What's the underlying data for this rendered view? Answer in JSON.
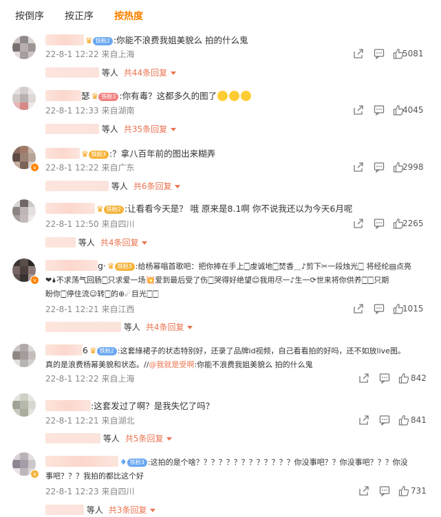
{
  "tabs": [
    "按倒序",
    "按正序",
    "按热度"
  ],
  "active_tab": "按热度",
  "colors": {
    "accent": "#ff8200",
    "link": "#eb7350",
    "meta": "#888888"
  },
  "action_icons": [
    "share-icon",
    "comment-icon",
    "like-icon"
  ],
  "comments": [
    {
      "badge": "铁粉2",
      "text": ":你能不浪费我姐美貌么 拍的什么鬼",
      "time": "22-8-1 12:22",
      "location": "来自上海",
      "likes": "5081",
      "reply_suffix": "等人",
      "reply_total": "共44条回复"
    },
    {
      "name_visible": "瑟",
      "badge": "铁粉3",
      "text": ":你有毒？这都多久的图了",
      "time": "22-8-1 12:33",
      "location": "来自湖南",
      "likes": "4045",
      "reply_suffix": "等人",
      "reply_total": "共35条回复"
    },
    {
      "badge": "铁粉3",
      "text": ":？拿八百年前的图出来糊弄",
      "time": "22-8-1 12:22",
      "location": "来自广东",
      "likes": "2998",
      "reply_suffix": "等人",
      "reply_total": "共6条回复"
    },
    {
      "badge": "铁粉2",
      "text": ":让看看今天是？ 哦 原来是8.1啊 你不说我还以为今天6月呢",
      "time": "22-8-1 12:50",
      "location": "来自四川",
      "likes": "2265",
      "reply_suffix": "等人",
      "reply_total": "共4条回复"
    },
    {
      "name_visible": "g·",
      "badge": "铁粉3",
      "text_line1": ":给杨幂唱首歌吧：把你捧在手上🀆虔诚地🀆焚香＿♪剪下✂一段烛光🀆 将经纶▤点亮",
      "text_line2": "❤🌢不求荡气回肠🀆只求爱一场💥爱到最后受了伤🀆哭得好绝望😊我用尽一♪生一⟳世来将你供养🀆🀆只期",
      "text_line3": "盼你🀆停住流☺转🀆的⊕☄目光🀆🀆",
      "time": "22-8-1 12:21",
      "location": "来自江西",
      "likes": "1015",
      "reply_suffix": "等人",
      "reply_total": "共4条回复"
    },
    {
      "name_visible": "6",
      "badge": "铁粉2",
      "text_line1": ":这套綠裙子的状态特别好，还录了品牌id视频，自己看看拍的好吗，还不如放live图。",
      "text_line2_a": "真的是浪费杨幂美貌和状态。//",
      "text_line2_link": "@我就是受啊",
      "text_line2_b": ":你能不浪费我姐美貌么 拍的什么鬼",
      "time": "22-8-1 12:22",
      "location": "来自上海",
      "likes": "842"
    },
    {
      "text": ":这套发过了啊？是我失忆了吗？",
      "time": "22-8-1 12:21",
      "location": "来自湖北",
      "likes": "841",
      "reply_suffix": "等人",
      "reply_total": "共5条回复"
    },
    {
      "badge": "铁粉3",
      "text_line1": ":这拍的是个啥？？？？？？？？？？？？？你没事吧？？你没事吧？？？你没",
      "text_line2": "事吧？？？我拍的都比这个好",
      "time": "22-8-1 12:23",
      "location": "来自四川",
      "likes": "731",
      "reply_suffix": "等人",
      "reply_total": "共3条回复"
    }
  ]
}
